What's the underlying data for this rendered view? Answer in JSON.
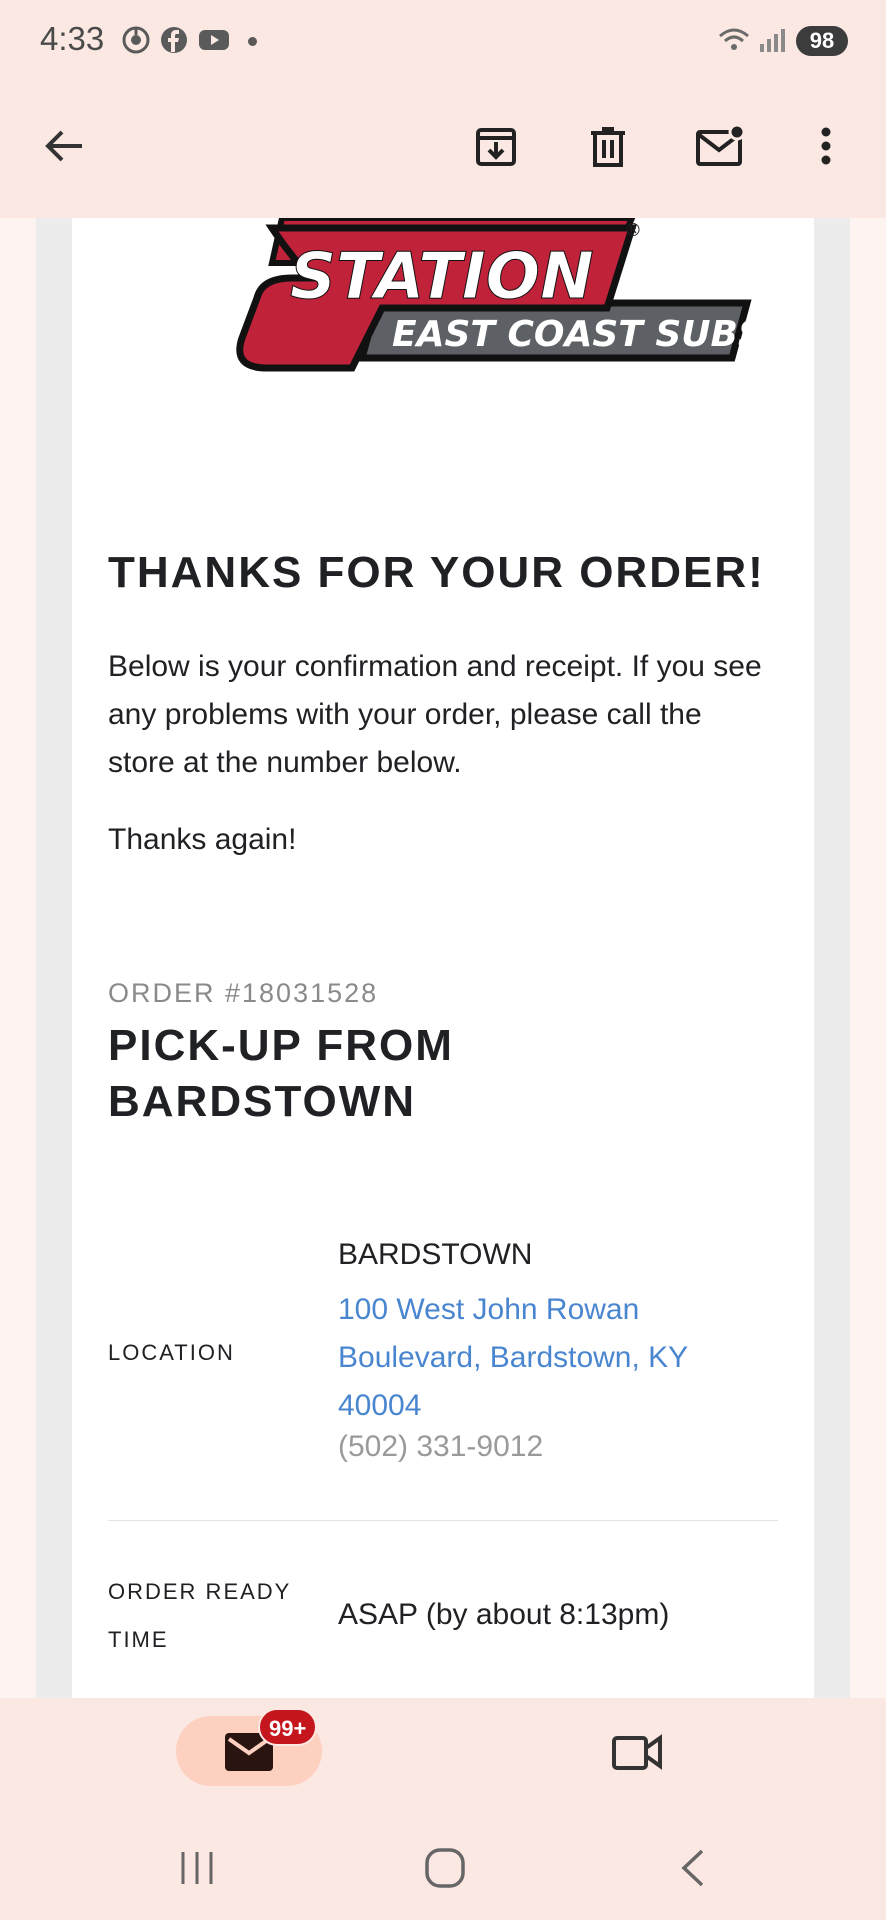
{
  "status_bar": {
    "time": "4:33",
    "battery": "98",
    "icons": [
      "chrome-icon",
      "facebook-icon",
      "youtube-icon",
      "wifi-icon",
      "signal-icon"
    ]
  },
  "app_bar": {
    "icons": [
      "back-arrow-icon",
      "archive-icon",
      "delete-icon",
      "mark-unread-icon",
      "more-vert-icon"
    ]
  },
  "email": {
    "logo": {
      "line1": "STATION",
      "line2": "EAST COAST SUBS",
      "registered": "®"
    },
    "heading": "THANKS FOR YOUR ORDER!",
    "intro": "Below is your confirmation and receipt. If you see any problems with your order, please call the store at the number below.",
    "thanks": "Thanks again!",
    "order_number": "ORDER #18031528",
    "pickup_title": "PICK-UP FROM BARDSTOWN",
    "location": {
      "label": "LOCATION",
      "name": "BARDSTOWN",
      "address": "100 West John Rowan Boulevard, Bardstown, KY 40004",
      "phone": "(502) 331-9012"
    },
    "ready": {
      "label": "ORDER READY TIME",
      "value": "ASAP (by about 8:13pm)"
    }
  },
  "bottom_nav": {
    "mail_badge": "99+",
    "icons": [
      "mail-icon",
      "video-icon"
    ]
  },
  "colors": {
    "accent_background": "#fbe8e2",
    "link": "#4a86d0",
    "brand_red": "#c0223a",
    "badge_red": "#c5161d"
  }
}
